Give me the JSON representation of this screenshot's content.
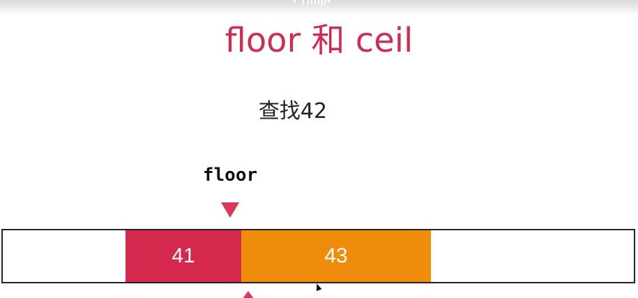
{
  "header": {
    "partial_text": "• Tillip•"
  },
  "slide": {
    "title": "floor 和 ceil",
    "subtitle": "查找42",
    "pointer_label": "floor"
  },
  "array": {
    "cells": [
      {
        "value": "41",
        "color": "#d4294d"
      },
      {
        "value": "43",
        "color": "#ef8c0b"
      }
    ]
  },
  "colors": {
    "title": "#cf2c4f",
    "pointer": "#d63a58",
    "border": "#222222"
  },
  "icons": {
    "pointer_down": "triangle-down-icon",
    "pointer_up": "triangle-up-icon",
    "cursor": "mouse-cursor-icon"
  }
}
